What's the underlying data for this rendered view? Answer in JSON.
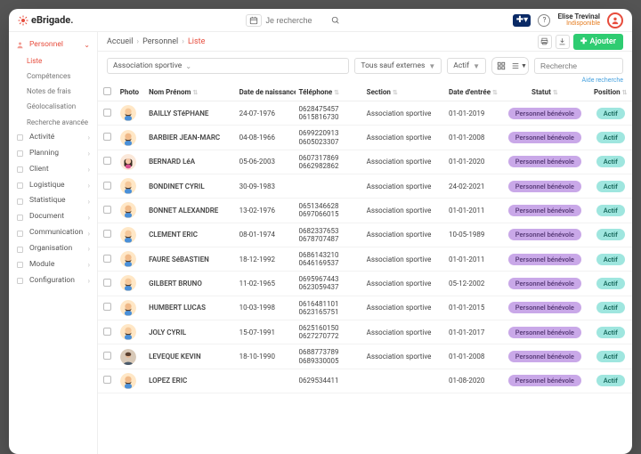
{
  "brand": "eBrigade.",
  "search_placeholder": "Je recherche",
  "user": {
    "name": "Elise Trevinal",
    "status": "Indisponible"
  },
  "breadcrumbs": [
    "Accueil",
    "Personnel",
    "Liste"
  ],
  "add_button": "Ajouter",
  "sidebar": {
    "main": {
      "label": "Personnel"
    },
    "sub": [
      {
        "label": "Liste",
        "active": true
      },
      {
        "label": "Compétences"
      },
      {
        "label": "Notes de frais"
      },
      {
        "label": "Géolocalisation"
      },
      {
        "label": "Recherche avancée"
      }
    ],
    "items": [
      {
        "label": "Activité"
      },
      {
        "label": "Planning"
      },
      {
        "label": "Client"
      },
      {
        "label": "Logistique"
      },
      {
        "label": "Statistique"
      },
      {
        "label": "Document"
      },
      {
        "label": "Communication"
      },
      {
        "label": "Organisation"
      },
      {
        "label": "Module"
      },
      {
        "label": "Configuration"
      }
    ]
  },
  "filters": {
    "section": "Association sportive",
    "scope": "Tous sauf externes",
    "status": "Actif",
    "search_placeholder": "Recherche",
    "help": "Aide recherche"
  },
  "columns": {
    "photo": "Photo",
    "name": "Nom Prénom",
    "dob": "Date de naissance",
    "phone": "Téléphone",
    "section": "Section",
    "entry": "Date d'entrée",
    "status": "Statut",
    "position": "Position"
  },
  "status_label": "Personnel bénévole",
  "position_label": "Actif",
  "rows": [
    {
      "name": "BAILLY STéPHANE",
      "dob": "24-07-1976",
      "p1": "0628475457",
      "p2": "0615816730",
      "section": "Association sportive",
      "entry": "01-01-2019",
      "avatar": "m1"
    },
    {
      "name": "BARBIER JEAN-MARC",
      "dob": "04-08-1966",
      "p1": "0699220913",
      "p2": "0605023307",
      "section": "Association sportive",
      "entry": "01-01-2008",
      "avatar": "m2"
    },
    {
      "name": "BERNARD LéA",
      "dob": "05-06-2003",
      "p1": "0607317869",
      "p2": "0662982862",
      "section": "Association sportive",
      "entry": "01-01-2020",
      "avatar": "f1"
    },
    {
      "name": "BONDINET CYRIL",
      "dob": "30-09-1983",
      "p1": "",
      "p2": "",
      "section": "Association sportive",
      "entry": "24-02-2021",
      "avatar": "m1"
    },
    {
      "name": "BONNET ALEXANDRE",
      "dob": "13-02-1976",
      "p1": "0651346628",
      "p2": "0697066015",
      "section": "Association sportive",
      "entry": "01-01-2011",
      "avatar": "m2"
    },
    {
      "name": "CLEMENT ERIC",
      "dob": "08-01-1974",
      "p1": "0682337653",
      "p2": "0678707487",
      "section": "Association sportive",
      "entry": "10-05-1989",
      "avatar": "m1"
    },
    {
      "name": "FAURE SéBASTIEN",
      "dob": "18-12-1992",
      "p1": "0686143210",
      "p2": "0646169537",
      "section": "Association sportive",
      "entry": "01-01-2011",
      "avatar": "m2"
    },
    {
      "name": "GILBERT BRUNO",
      "dob": "11-02-1965",
      "p1": "0695967443",
      "p2": "0623059437",
      "section": "Association sportive",
      "entry": "05-12-2002",
      "avatar": "m1"
    },
    {
      "name": "HUMBERT LUCAS",
      "dob": "10-03-1998",
      "p1": "0616481101",
      "p2": "0623165751",
      "section": "Association sportive",
      "entry": "01-01-2015",
      "avatar": "m2"
    },
    {
      "name": "JOLY CYRIL",
      "dob": "15-07-1991",
      "p1": "0625160150",
      "p2": "0627270772",
      "section": "Association sportive",
      "entry": "01-01-2017",
      "avatar": "m1"
    },
    {
      "name": "LEVEQUE KEVIN",
      "dob": "18-10-1990",
      "p1": "0688773789",
      "p2": "0689330005",
      "section": "Association sportive",
      "entry": "01-01-2008",
      "avatar": "photo"
    },
    {
      "name": "LOPEZ ERIC",
      "dob": "",
      "p1": "0629534411",
      "p2": "",
      "section": "",
      "entry": "01-08-2020",
      "avatar": "m2"
    }
  ]
}
